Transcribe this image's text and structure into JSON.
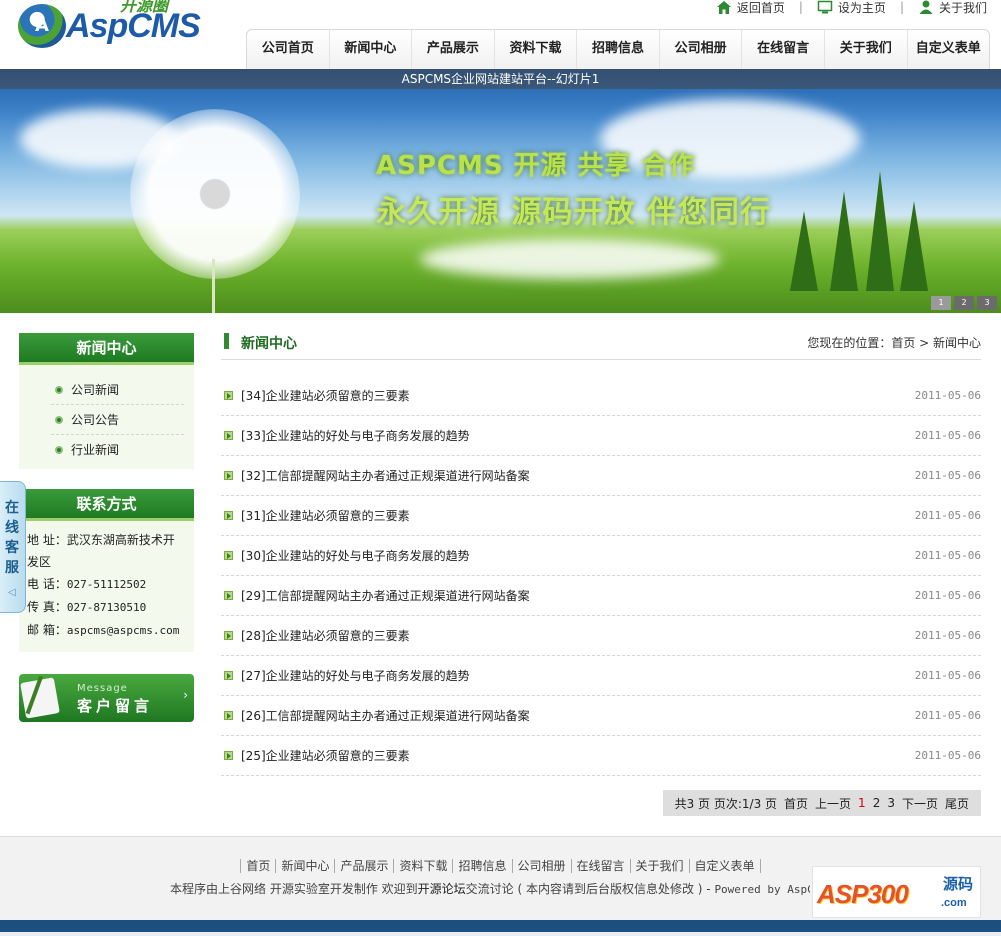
{
  "logo": {
    "brand": "AspCMS",
    "sub": "开源圈",
    "mark": "A"
  },
  "toplinks": [
    {
      "label": "返回首页",
      "icon": "home-icon"
    },
    {
      "label": "设为主页",
      "icon": "monitor-icon"
    },
    {
      "label": "关于我们",
      "icon": "user-icon"
    }
  ],
  "nav": [
    "公司首页",
    "新闻中心",
    "产品展示",
    "资料下载",
    "招聘信息",
    "公司相册",
    "在线留言",
    "关于我们",
    "自定义表单"
  ],
  "banner": {
    "caption": "ASPCMS企业网站建站平台--幻灯片1",
    "line1": "ASPCMS 开源   共享  合作",
    "line2": "永久开源 源码开放  伴您同行",
    "slides": [
      "1",
      "2",
      "3"
    ],
    "active_slide": 1
  },
  "sidebar": {
    "news_title": "新闻中心",
    "categories": [
      "公司新闻",
      "公司公告",
      "行业新闻"
    ],
    "contact_title": "联系方式",
    "contact": {
      "address_label": "地 址：",
      "address": "武汉东湖高新技术开发区",
      "phone_label": "电 话：",
      "phone": "027-51112502",
      "fax_label": "传 真：",
      "fax": "027-87130510",
      "email_label": "邮 箱：",
      "email": "aspcms@aspcms.com"
    },
    "message_button": {
      "small": "Message",
      "big": "客户留言",
      "arrow": "›"
    }
  },
  "online_service": {
    "label": "在线客服",
    "arrow": "◁"
  },
  "main": {
    "title": "新闻中心",
    "breadcrumb": "您现在的位置：首页 > 新闻中心",
    "news": [
      {
        "title": "[34]企业建站必须留意的三要素",
        "date": "2011-05-06"
      },
      {
        "title": "[33]企业建站的好处与电子商务发展的趋势",
        "date": "2011-05-06"
      },
      {
        "title": "[32]工信部提醒网站主办者通过正规渠道进行网站备案",
        "date": "2011-05-06"
      },
      {
        "title": "[31]企业建站必须留意的三要素",
        "date": "2011-05-06"
      },
      {
        "title": "[30]企业建站的好处与电子商务发展的趋势",
        "date": "2011-05-06"
      },
      {
        "title": "[29]工信部提醒网站主办者通过正规渠道进行网站备案",
        "date": "2011-05-06"
      },
      {
        "title": "[28]企业建站必须留意的三要素",
        "date": "2011-05-06"
      },
      {
        "title": "[27]企业建站的好处与电子商务发展的趋势",
        "date": "2011-05-06"
      },
      {
        "title": "[26]工信部提醒网站主办者通过正规渠道进行网站备案",
        "date": "2011-05-06"
      },
      {
        "title": "[25]企业建站必须留意的三要素",
        "date": "2011-05-06"
      }
    ],
    "pager": {
      "summary": "共3 页 页次:1/3 页",
      "first": "首页",
      "prev": "上一页",
      "pages": [
        "1",
        "2",
        "3"
      ],
      "current_page": 1,
      "next": "下一页",
      "last": "尾页"
    }
  },
  "footer": {
    "links": [
      "首页",
      "新闻中心",
      "产品展示",
      "资料下载",
      "招聘信息",
      "公司相册",
      "在线留言",
      "关于我们",
      "自定义表单"
    ],
    "line2_prefix": "本程序由上谷网络 开源实验室开发制作 欢迎到",
    "forum": "开源论坛",
    "line2_middle": "交流讨论 ( 本内容请到后台版权信息处修改 ) - ",
    "powered": "Powered by AspCMS"
  },
  "watermark": {
    "main": "ASP300",
    "cn": "源码",
    "com": ".com"
  },
  "colors": {
    "accent_green": "#2f8a32",
    "nav_text": "#222222",
    "current_page": "#d40000",
    "footer_bar": "#1b4f7e"
  }
}
